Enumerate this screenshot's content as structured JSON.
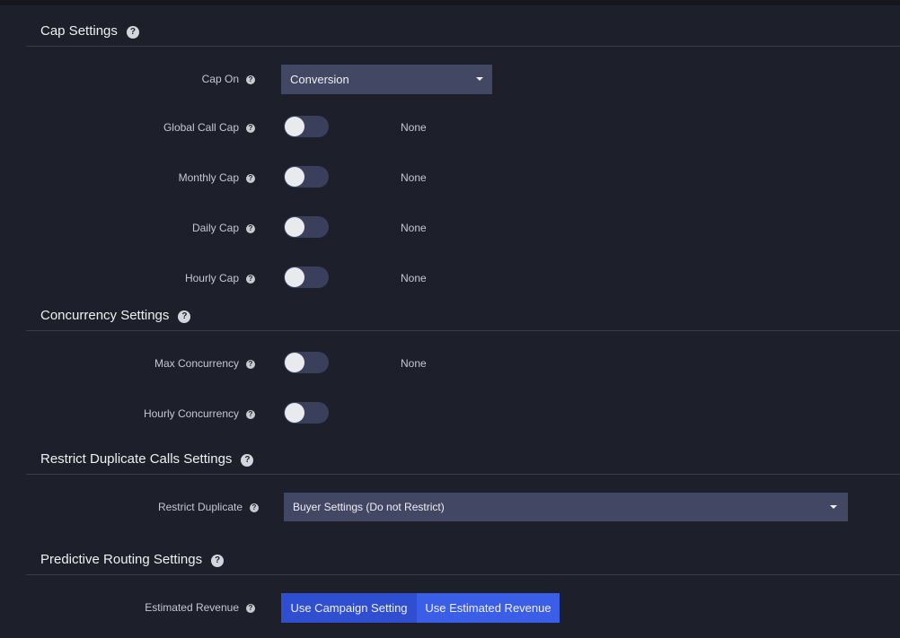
{
  "cap_settings": {
    "title": "Cap Settings",
    "cap_on": {
      "label": "Cap On",
      "value": "Conversion"
    },
    "global_call_cap": {
      "label": "Global Call Cap",
      "enabled": false,
      "value": "None"
    },
    "monthly_cap": {
      "label": "Monthly Cap",
      "enabled": false,
      "value": "None"
    },
    "daily_cap": {
      "label": "Daily Cap",
      "enabled": false,
      "value": "None"
    },
    "hourly_cap": {
      "label": "Hourly Cap",
      "enabled": false,
      "value": "None"
    }
  },
  "concurrency_settings": {
    "title": "Concurrency Settings",
    "max_concurrency": {
      "label": "Max Concurrency",
      "enabled": false,
      "value": "None"
    },
    "hourly_concurrency": {
      "label": "Hourly Concurrency",
      "enabled": false
    }
  },
  "restrict_duplicate_settings": {
    "title": "Restrict Duplicate Calls Settings",
    "restrict_duplicate": {
      "label": "Restrict Duplicate",
      "value": "Buyer Settings (Do not Restrict)"
    }
  },
  "predictive_routing_settings": {
    "title": "Predictive Routing Settings",
    "estimated_revenue": {
      "label": "Estimated Revenue",
      "options": [
        "Use Campaign Setting",
        "Use Estimated Revenue"
      ],
      "selected": "Use Estimated Revenue"
    }
  },
  "help_glyph": "?",
  "icons": {
    "help": "question-circle-icon",
    "dropdown": "caret-down-icon"
  },
  "colors": {
    "background": "#1d1f2b",
    "control": "#424863",
    "toggle_track": "#3a3f5c",
    "button_active": "#3b5ee8",
    "button_inactive": "#2f4fd0"
  }
}
